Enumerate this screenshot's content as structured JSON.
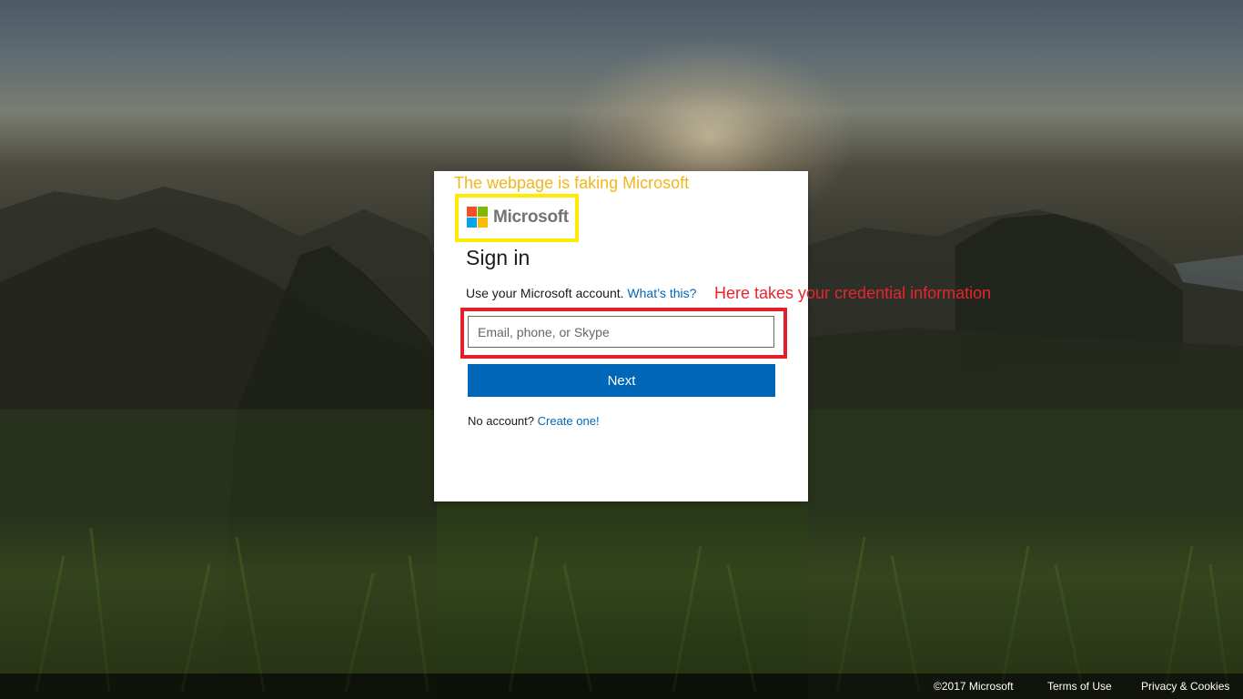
{
  "annotations": {
    "top": "The webpage is faking Microsoft",
    "middle": "Here takes your credential information"
  },
  "logo": {
    "text": "Microsoft",
    "colors": [
      "#f25022",
      "#7fba00",
      "#00a4ef",
      "#ffb900"
    ]
  },
  "signin": {
    "title": "Sign in",
    "subtitle": "Use your Microsoft account.",
    "whats_this": "What’s this?",
    "email_placeholder": "Email, phone, or Skype",
    "next_label": "Next",
    "no_account": "No account?",
    "create_one": "Create one!"
  },
  "footer": {
    "copyright": "©2017 Microsoft",
    "terms": "Terms of Use",
    "privacy": "Privacy & Cookies"
  },
  "colors": {
    "accent": "#0067b8",
    "annotation_yellow": "#f2b619",
    "highlight_yellow": "#ffeb00",
    "annotation_red": "#e8252c",
    "highlight_red": "#e3202a"
  }
}
